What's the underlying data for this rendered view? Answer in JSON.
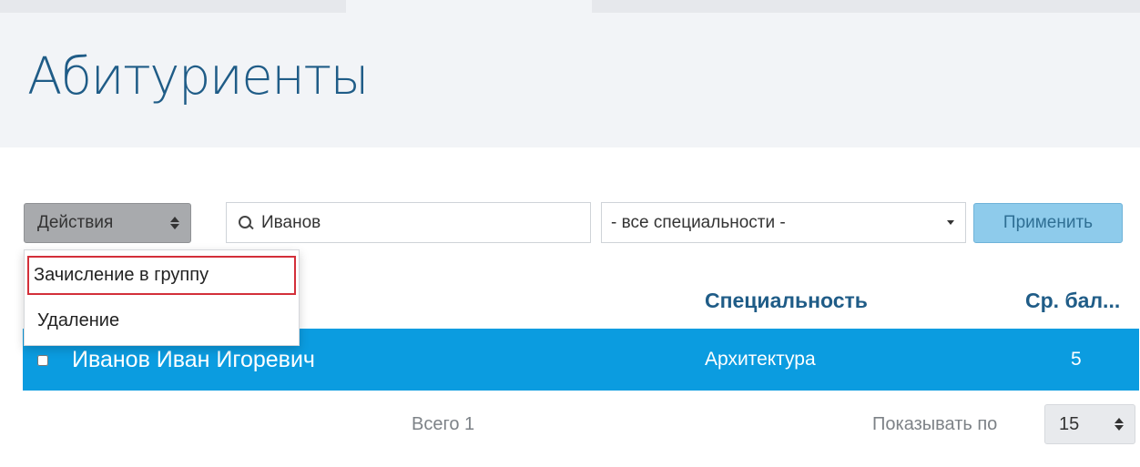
{
  "header": {
    "title": "Абитуриенты"
  },
  "toolbar": {
    "actions_label": "Действия",
    "search_value": "Иванов",
    "specialty_select": "- все специальности -",
    "apply_label": "Применить"
  },
  "actions_menu": {
    "items": [
      {
        "label": "Зачисление в группу",
        "highlighted": true
      },
      {
        "label": "Удаление",
        "highlighted": false
      }
    ]
  },
  "table": {
    "columns": [
      "Специальность",
      "Ср. бал..."
    ],
    "rows": [
      {
        "name": "Иванов Иван Игоревич",
        "specialty": "Архитектура",
        "score": "5",
        "selected": true
      }
    ]
  },
  "footer": {
    "total": "Всего 1",
    "page_size_label": "Показывать по",
    "page_size_value": "15"
  },
  "colors": {
    "title": "#1f5c87",
    "row_selected": "#0b9ce0",
    "apply_button": "#8ecbeb",
    "menu_highlight_border": "#d32f3a"
  },
  "icons": [
    "sort-icon",
    "search-icon",
    "caret-down-icon",
    "checkbox-icon"
  ]
}
